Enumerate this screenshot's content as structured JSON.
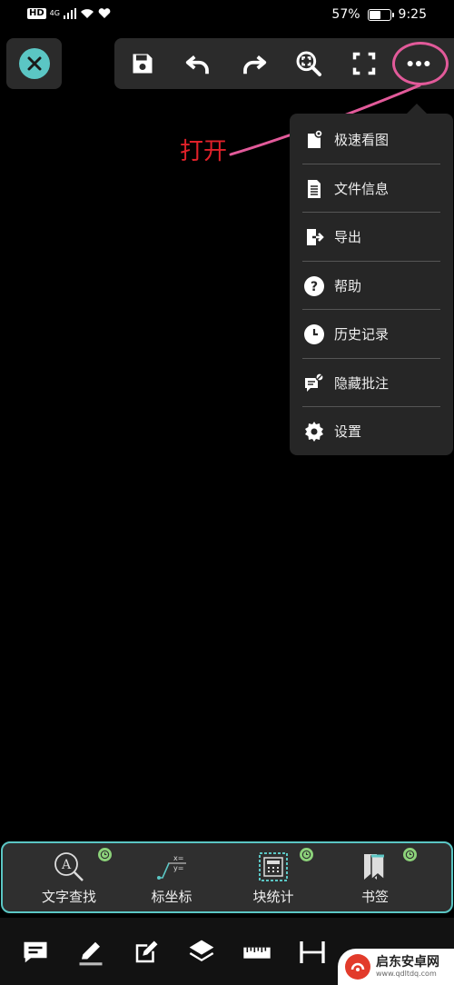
{
  "status_bar": {
    "hd": "HD",
    "network": "4G",
    "battery_percent": "57%",
    "battery_level": 0.57,
    "time": "9:25"
  },
  "toolbar": {
    "buttons": [
      "save-icon",
      "undo-icon",
      "redo-icon",
      "zoom-fit-icon",
      "fullscreen-icon",
      "more-icon"
    ]
  },
  "annotation": {
    "text": "打开",
    "color": "#e0212a",
    "circle_color": "#e25a9a"
  },
  "menu": {
    "items": [
      {
        "label": "极速看图",
        "icon": "quick-view-icon"
      },
      {
        "label": "文件信息",
        "icon": "file-info-icon"
      },
      {
        "label": "导出",
        "icon": "export-icon"
      },
      {
        "label": "帮助",
        "icon": "help-icon"
      },
      {
        "label": "历史记录",
        "icon": "history-icon"
      },
      {
        "label": "隐藏批注",
        "icon": "hide-annotation-icon"
      },
      {
        "label": "设置",
        "icon": "settings-icon"
      }
    ]
  },
  "tools": {
    "accent": "#5bc6c4",
    "items": [
      {
        "label": "文字查找",
        "icon": "text-search-icon",
        "badge": true
      },
      {
        "label": "标坐标",
        "icon": "coordinate-icon",
        "badge": false
      },
      {
        "label": "块统计",
        "icon": "block-stats-icon",
        "badge": true
      },
      {
        "label": "书签",
        "icon": "bookmark-icon",
        "badge": true
      }
    ]
  },
  "bottom_nav": {
    "items": [
      "comment-icon",
      "pencil-icon",
      "edit-icon",
      "layers-icon",
      "ruler-icon",
      "dimension-icon"
    ]
  },
  "watermark": {
    "name": "启东安卓网",
    "url": "www.qdltdq.com"
  }
}
